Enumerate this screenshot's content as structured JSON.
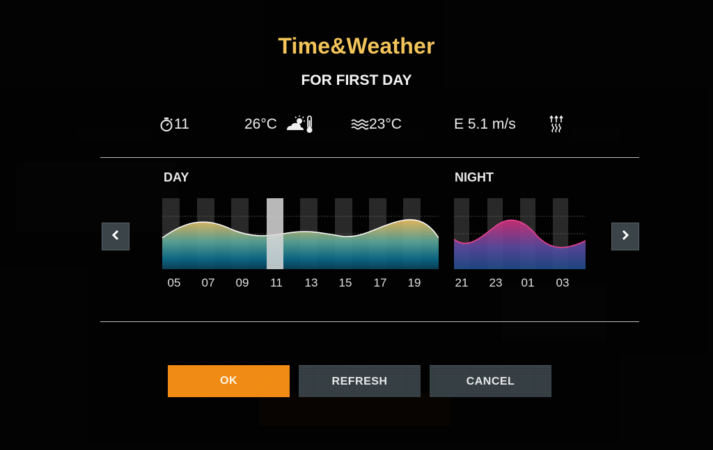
{
  "dialog": {
    "title": "Time&Weather",
    "subtitle": "FOR FIRST DAY"
  },
  "stats": {
    "time_value": "11",
    "time_icon": "stopwatch-icon",
    "air_temp": "26°C",
    "air_icon": "sun-cloud-thermometer-icon",
    "water_temp": "23°C",
    "water_icon": "water-waves-icon",
    "wind": "E 5.1 m/s",
    "pressure_icon": "pressure-arrows-icon"
  },
  "day": {
    "label": "DAY",
    "hours": [
      "05",
      "07",
      "09",
      "11",
      "13",
      "15",
      "17",
      "19"
    ],
    "selected_hour": "11"
  },
  "night": {
    "label": "NIGHT",
    "hours": [
      "21",
      "23",
      "01",
      "03"
    ]
  },
  "nav": {
    "prev_icon": "chevron-left-icon",
    "next_icon": "chevron-right-icon"
  },
  "buttons": {
    "ok": "OK",
    "refresh": "REFRESH",
    "cancel": "CANCEL"
  },
  "colors": {
    "accent": "#f08a12",
    "title": "#f2c45a",
    "day_curve_top": "#f0c060",
    "day_curve_bottom": "#0b6b8a",
    "night_curve_top": "#c8307a",
    "night_curve_bottom": "#2a4c8c"
  }
}
